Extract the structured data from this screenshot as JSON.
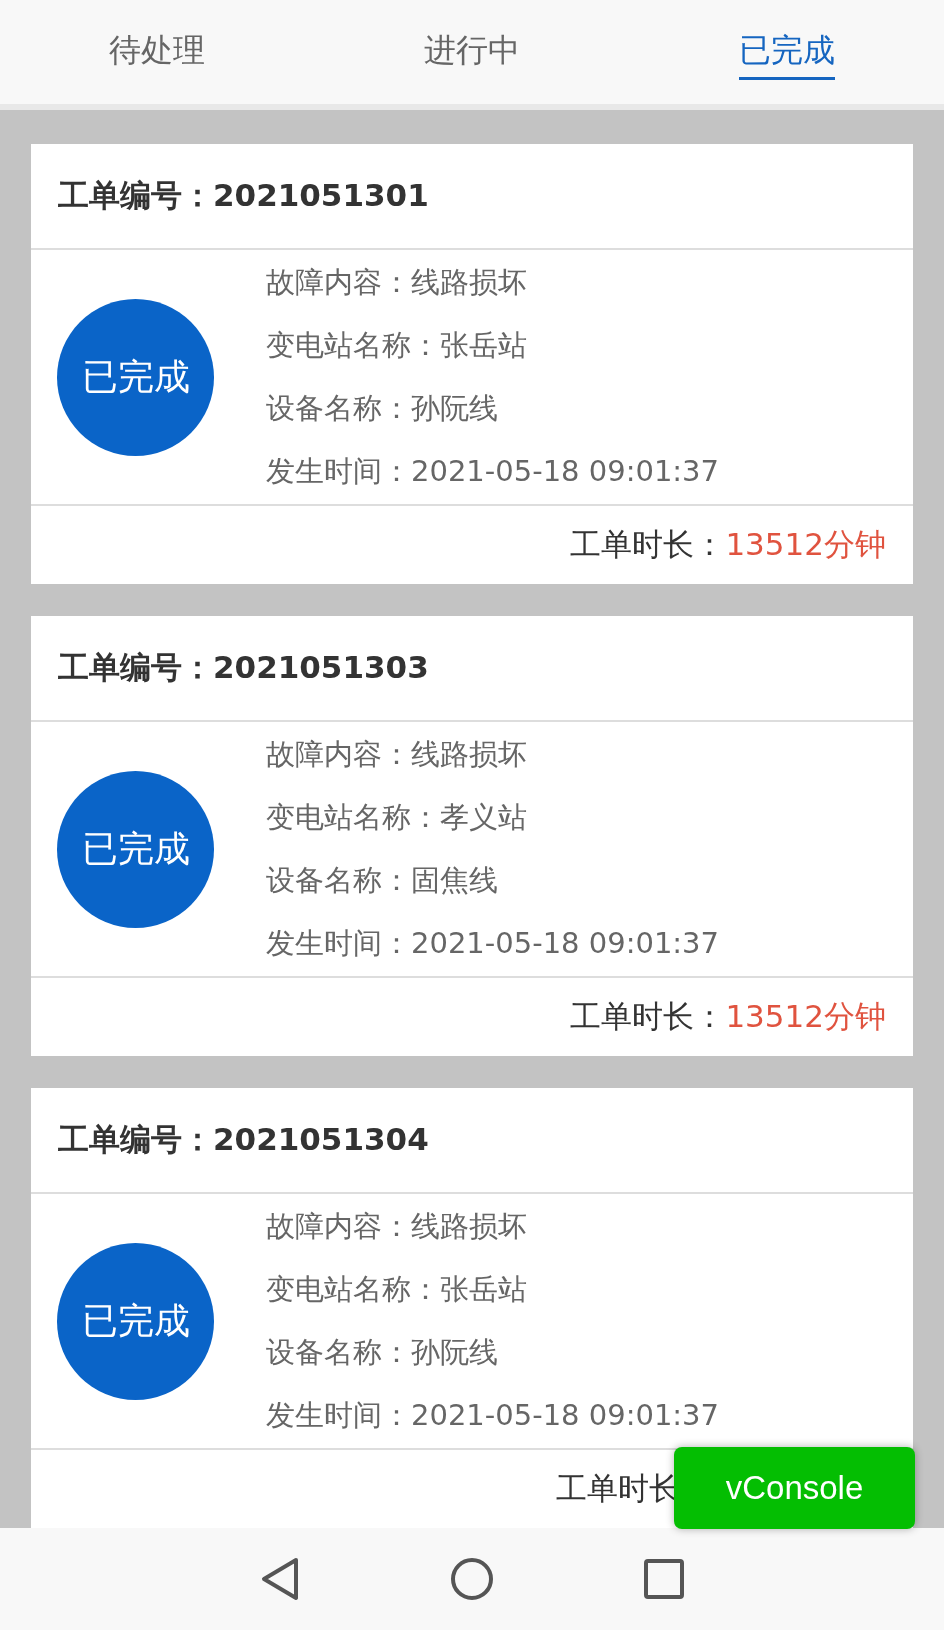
{
  "tabs": [
    {
      "label": "待处理",
      "selected": false
    },
    {
      "label": "进行中",
      "selected": false
    },
    {
      "label": "已完成",
      "selected": true
    }
  ],
  "orders": [
    {
      "title": "工单编号：2021051301",
      "status": "已完成",
      "fields": [
        "故障内容：线路损坏",
        "变电站名称：张岳站",
        "设备名称：孙阮线",
        "发生时间：2021-05-18 09:01:37"
      ],
      "duration_label": "工单时长：",
      "duration": "13512分钟"
    },
    {
      "title": "工单编号：2021051303",
      "status": "已完成",
      "fields": [
        "故障内容：线路损坏",
        "变电站名称：孝义站",
        "设备名称：固焦线",
        "发生时间：2021-05-18 09:01:37"
      ],
      "duration_label": "工单时长：",
      "duration": "13512分钟"
    },
    {
      "title": "工单编号：2021051304",
      "status": "已完成",
      "fields": [
        "故障内容：线路损坏",
        "变电站名称：张岳站",
        "设备名称：孙阮线",
        "发生时间：2021-05-18 09:01:37"
      ],
      "duration_label": "工单时长"
    }
  ],
  "console_button": "vConsole"
}
